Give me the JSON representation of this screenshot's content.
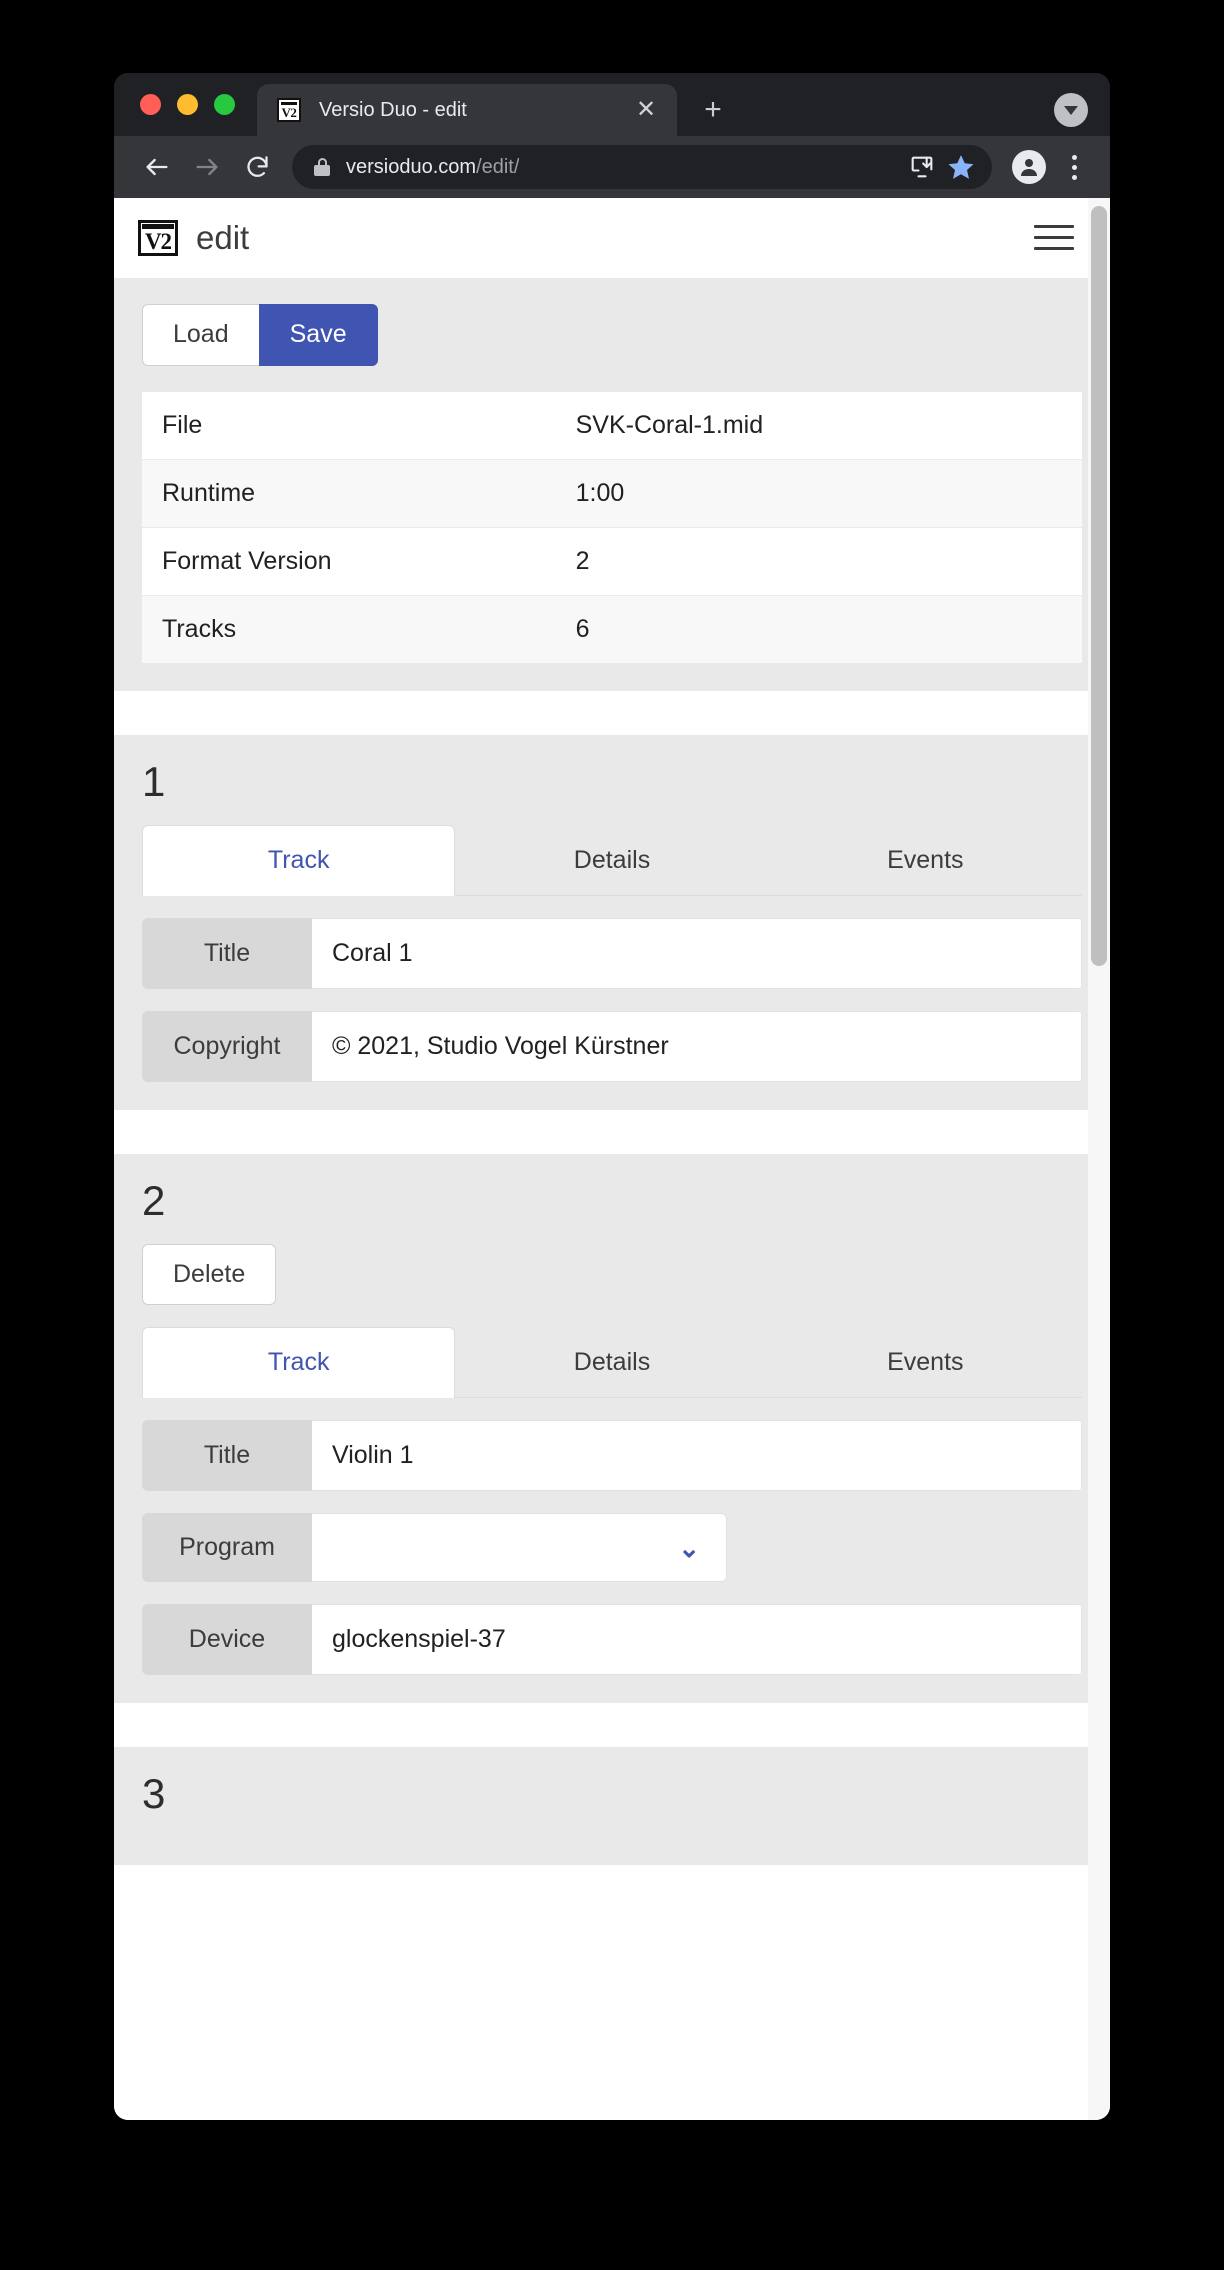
{
  "browser": {
    "tab": {
      "title": "Versio Duo - edit",
      "favicon_label": "V2",
      "favicon_icon": "v2-logo-icon",
      "close_icon": "close-icon"
    },
    "new_tab_icon": "plus-icon",
    "tab_list_icon": "chevron-down-circle-icon",
    "toolbar": {
      "back_icon": "back-arrow-icon",
      "forward_icon": "forward-arrow-icon",
      "reload_icon": "reload-icon",
      "lock_icon": "lock-icon",
      "url_domain": "versioduo.com",
      "url_path": "/edit/",
      "install_icon": "install-app-icon",
      "bookmark_icon": "star-icon",
      "profile_icon": "profile-avatar-icon",
      "menu_icon": "kebab-menu-icon"
    },
    "traffic_lights": {
      "close": "#ff5f57",
      "minimize": "#febc2e",
      "maximize": "#28c840"
    }
  },
  "app": {
    "logo_label": "V2",
    "title": "edit",
    "menu_icon": "hamburger-menu-icon"
  },
  "toolbar": {
    "load_label": "Load",
    "save_label": "Save"
  },
  "file_info": {
    "rows": [
      {
        "key": "File",
        "value": "SVK-Coral-1.mid"
      },
      {
        "key": "Runtime",
        "value": "1:00"
      },
      {
        "key": "Format Version",
        "value": "2"
      },
      {
        "key": "Tracks",
        "value": "6"
      }
    ]
  },
  "tracks": [
    {
      "number": "1",
      "tabs": [
        {
          "label": "Track",
          "active": true
        },
        {
          "label": "Details",
          "active": false
        },
        {
          "label": "Events",
          "active": false
        }
      ],
      "fields": [
        {
          "label": "Title",
          "value": "Coral 1",
          "type": "text"
        },
        {
          "label": "Copyright",
          "value": "© 2021, Studio Vogel Kürstner",
          "type": "text"
        }
      ]
    },
    {
      "number": "2",
      "delete_label": "Delete",
      "tabs": [
        {
          "label": "Track",
          "active": true
        },
        {
          "label": "Details",
          "active": false
        },
        {
          "label": "Events",
          "active": false
        }
      ],
      "fields": [
        {
          "label": "Title",
          "value": "Violin 1",
          "type": "text"
        },
        {
          "label": "Program",
          "value": "",
          "type": "select"
        },
        {
          "label": "Device",
          "value": "glockenspiel-37",
          "type": "text"
        }
      ]
    },
    {
      "number": "3"
    }
  ],
  "colors": {
    "accent": "#4054b2",
    "page_bg": "#e9e9e9",
    "chrome_bg": "#35363a",
    "chrome_dark": "#202124"
  }
}
